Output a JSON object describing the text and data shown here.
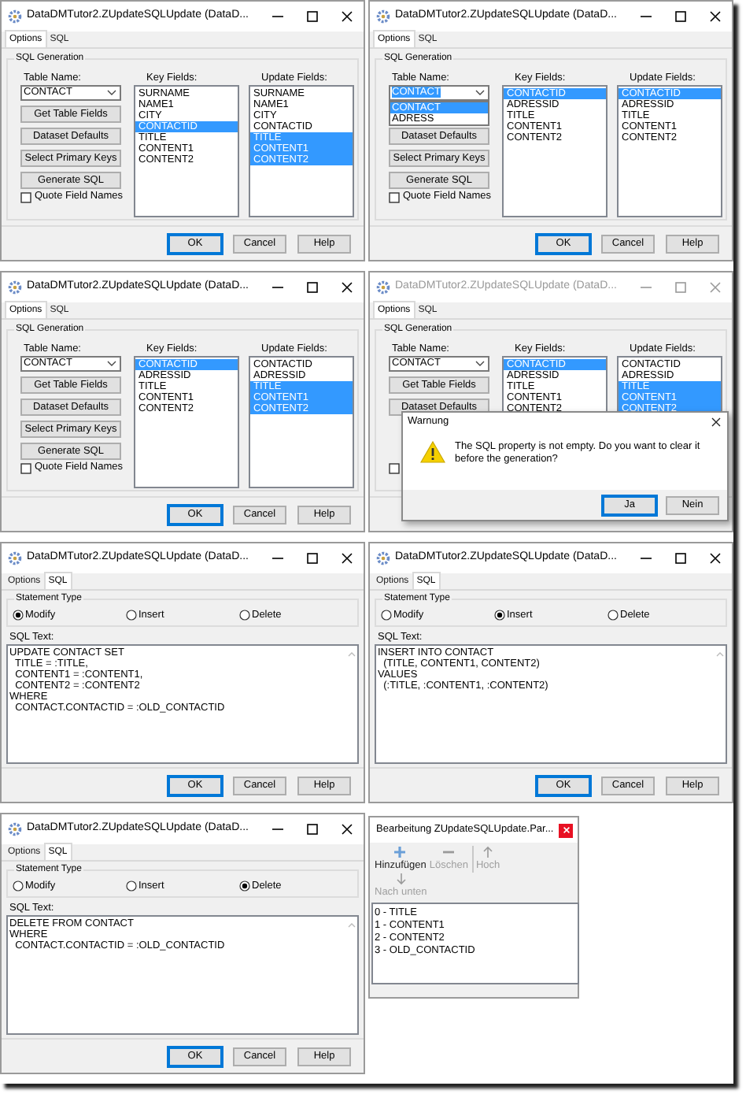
{
  "dialogs": [
    {
      "kind": "options",
      "title": "DataDMTutor2.ZUpdateSQLUpdate (DataD...",
      "active": true,
      "tabs": [
        {
          "label": "Options",
          "selected": true
        },
        {
          "label": "SQL",
          "selected": false
        }
      ],
      "group": "SQL Generation",
      "table_label": "Table Name:",
      "table_value": "CONTACT",
      "table_focused": false,
      "actions": [
        "Get Table Fields",
        "Dataset Defaults",
        "Select Primary Keys",
        "Generate SQL"
      ],
      "quote": {
        "label": "Quote Field Names",
        "checked": false
      },
      "key_fields": {
        "label": "Key Fields:",
        "items": [
          {
            "text": "SURNAME",
            "selected": false
          },
          {
            "text": "NAME1",
            "selected": false
          },
          {
            "text": "CITY",
            "selected": false
          },
          {
            "text": "CONTACTID",
            "selected": true
          },
          {
            "text": "TITLE",
            "selected": false
          },
          {
            "text": "CONTENT1",
            "selected": false
          },
          {
            "text": "CONTENT2",
            "selected": false
          }
        ]
      },
      "update_fields": {
        "label": "Update Fields:",
        "items": [
          {
            "text": "SURNAME",
            "selected": false
          },
          {
            "text": "NAME1",
            "selected": false
          },
          {
            "text": "CITY",
            "selected": false
          },
          {
            "text": "CONTACTID",
            "selected": false
          },
          {
            "text": "TITLE",
            "selected": true
          },
          {
            "text": "CONTENT1",
            "selected": true
          },
          {
            "text": "CONTENT2",
            "selected": true
          }
        ]
      },
      "footer": [
        {
          "label": "OK",
          "default": true
        },
        {
          "label": "Cancel",
          "default": false
        },
        {
          "label": "Help",
          "default": false
        }
      ]
    },
    {
      "kind": "options",
      "title": "DataDMTutor2.ZUpdateSQLUpdate (DataD...",
      "active": true,
      "tabs": [
        {
          "label": "Options",
          "selected": true
        },
        {
          "label": "SQL",
          "selected": false
        }
      ],
      "group": "SQL Generation",
      "table_label": "Table Name:",
      "table_value": "CONTACT",
      "table_focused": true,
      "dropdown": [
        {
          "text": "CONTACT",
          "selected": true
        },
        {
          "text": "ADRESS",
          "selected": false
        }
      ],
      "actions": [
        "Dataset Defaults",
        "Select Primary Keys",
        "Generate SQL"
      ],
      "quote": {
        "label": "Quote Field Names",
        "checked": false
      },
      "key_fields": {
        "label": "Key Fields:",
        "items": [
          {
            "text": "CONTACTID",
            "selected": true
          },
          {
            "text": "ADRESSID",
            "selected": false
          },
          {
            "text": "TITLE",
            "selected": false
          },
          {
            "text": "CONTENT1",
            "selected": false
          },
          {
            "text": "CONTENT2",
            "selected": false
          }
        ]
      },
      "update_fields": {
        "label": "Update Fields:",
        "items": [
          {
            "text": "CONTACTID",
            "selected": true
          },
          {
            "text": "ADRESSID",
            "selected": false
          },
          {
            "text": "TITLE",
            "selected": false
          },
          {
            "text": "CONTENT1",
            "selected": false
          },
          {
            "text": "CONTENT2",
            "selected": false
          }
        ]
      },
      "footer": [
        {
          "label": "OK",
          "default": true
        },
        {
          "label": "Cancel",
          "default": false
        },
        {
          "label": "Help",
          "default": false
        }
      ]
    },
    {
      "kind": "options",
      "title": "DataDMTutor2.ZUpdateSQLUpdate (DataD...",
      "active": true,
      "tabs": [
        {
          "label": "Options",
          "selected": true
        },
        {
          "label": "SQL",
          "selected": false
        }
      ],
      "group": "SQL Generation",
      "table_label": "Table Name:",
      "table_value": "CONTACT",
      "table_focused": false,
      "actions": [
        "Get Table Fields",
        "Dataset Defaults",
        "Select Primary Keys",
        "Generate SQL"
      ],
      "quote": {
        "label": "Quote Field Names",
        "checked": false
      },
      "key_fields": {
        "label": "Key Fields:",
        "items": [
          {
            "text": "CONTACTID",
            "selected": true
          },
          {
            "text": "ADRESSID",
            "selected": false
          },
          {
            "text": "TITLE",
            "selected": false
          },
          {
            "text": "CONTENT1",
            "selected": false
          },
          {
            "text": "CONTENT2",
            "selected": false
          }
        ]
      },
      "update_fields": {
        "label": "Update Fields:",
        "items": [
          {
            "text": "CONTACTID",
            "selected": false
          },
          {
            "text": "ADRESSID",
            "selected": false
          },
          {
            "text": "TITLE",
            "selected": true
          },
          {
            "text": "CONTENT1",
            "selected": true
          },
          {
            "text": "CONTENT2",
            "selected": true
          }
        ]
      },
      "footer": [
        {
          "label": "OK",
          "default": true
        },
        {
          "label": "Cancel",
          "default": false
        },
        {
          "label": "Help",
          "default": false
        }
      ]
    },
    {
      "kind": "options",
      "title": "DataDMTutor2.ZUpdateSQLUpdate (DataD...",
      "active": false,
      "tabs": [
        {
          "label": "Options",
          "selected": true
        },
        {
          "label": "SQL",
          "selected": false
        }
      ],
      "group": "SQL Generation",
      "table_label": "Table Name:",
      "table_value": "CONTACT",
      "table_focused": false,
      "actions": [
        "Get Table Fields",
        "Dataset Defaults"
      ],
      "quote": {
        "checked": false
      },
      "key_fields": {
        "label": "Key Fields:",
        "items": [
          {
            "text": "CONTACTID",
            "selected": true
          },
          {
            "text": "ADRESSID",
            "selected": false
          },
          {
            "text": "TITLE",
            "selected": false
          },
          {
            "text": "CONTENT1",
            "selected": false
          },
          {
            "text": "CONTENT2",
            "selected": false
          }
        ]
      },
      "update_fields": {
        "label": "Update Fields:",
        "items": [
          {
            "text": "CONTACTID",
            "selected": false
          },
          {
            "text": "ADRESSID",
            "selected": false
          },
          {
            "text": "TITLE",
            "selected": true
          },
          {
            "text": "CONTENT1",
            "selected": true
          },
          {
            "text": "CONTENT2",
            "selected": true
          }
        ]
      },
      "warning": {
        "title": "Warnung",
        "message": "The SQL property is not empty. Do you want to clear it before the generation?",
        "buttons": [
          {
            "label": "Ja",
            "default": true
          },
          {
            "label": "Nein",
            "default": false
          }
        ]
      }
    },
    {
      "kind": "sql",
      "title": "DataDMTutor2.ZUpdateSQLUpdate (DataD...",
      "active": true,
      "tabs": [
        {
          "label": "Options",
          "selected": false
        },
        {
          "label": "SQL",
          "selected": true
        }
      ],
      "group": "Statement Type",
      "statement_types": [
        {
          "label": "Modify",
          "selected": true
        },
        {
          "label": "Insert",
          "selected": false
        },
        {
          "label": "Delete",
          "selected": false
        }
      ],
      "sql_label": "SQL Text:",
      "sql_text": "UPDATE CONTACT SET\n  TITLE = :TITLE,\n  CONTENT1 = :CONTENT1,\n  CONTENT2 = :CONTENT2\nWHERE\n  CONTACT.CONTACTID = :OLD_CONTACTID",
      "footer": [
        {
          "label": "OK",
          "default": true
        },
        {
          "label": "Cancel",
          "default": false
        },
        {
          "label": "Help",
          "default": false
        }
      ]
    },
    {
      "kind": "sql",
      "title": "DataDMTutor2.ZUpdateSQLUpdate (DataD...",
      "active": true,
      "tabs": [
        {
          "label": "Options",
          "selected": false
        },
        {
          "label": "SQL",
          "selected": true
        }
      ],
      "group": "Statement Type",
      "statement_types": [
        {
          "label": "Modify",
          "selected": false
        },
        {
          "label": "Insert",
          "selected": true
        },
        {
          "label": "Delete",
          "selected": false
        }
      ],
      "sql_label": "SQL Text:",
      "sql_text": "INSERT INTO CONTACT\n  (TITLE, CONTENT1, CONTENT2)\nVALUES\n  (:TITLE, :CONTENT1, :CONTENT2)",
      "footer": [
        {
          "label": "OK",
          "default": true
        },
        {
          "label": "Cancel",
          "default": false
        },
        {
          "label": "Help",
          "default": false
        }
      ]
    },
    {
      "kind": "sql",
      "title": "DataDMTutor2.ZUpdateSQLUpdate (DataD...",
      "active": true,
      "tabs": [
        {
          "label": "Options",
          "selected": false
        },
        {
          "label": "SQL",
          "selected": true
        }
      ],
      "group": "Statement Type",
      "statement_types": [
        {
          "label": "Modify",
          "selected": false
        },
        {
          "label": "Insert",
          "selected": false
        },
        {
          "label": "Delete",
          "selected": true
        }
      ],
      "sql_label": "SQL Text:",
      "sql_text": "DELETE FROM CONTACT\nWHERE\n  CONTACT.CONTACTID = :OLD_CONTACTID",
      "footer": [
        {
          "label": "OK",
          "default": true
        },
        {
          "label": "Cancel",
          "default": false
        },
        {
          "label": "Help",
          "default": false
        }
      ]
    },
    {
      "kind": "params",
      "title": "Bearbeitung ZUpdateSQLUpdate.Par...",
      "toolbar": [
        {
          "label": "Hinzufügen",
          "kind": "add",
          "disabled": false
        },
        {
          "label": "Löschen",
          "kind": "delete",
          "disabled": true
        },
        {
          "label": "Hoch",
          "kind": "up",
          "disabled": true
        },
        {
          "label": "Nach unten",
          "kind": "down",
          "disabled": true
        }
      ],
      "items": [
        "0 - TITLE",
        "1 - CONTENT1",
        "2 - CONTENT2",
        "3 - OLD_CONTACTID"
      ]
    }
  ]
}
